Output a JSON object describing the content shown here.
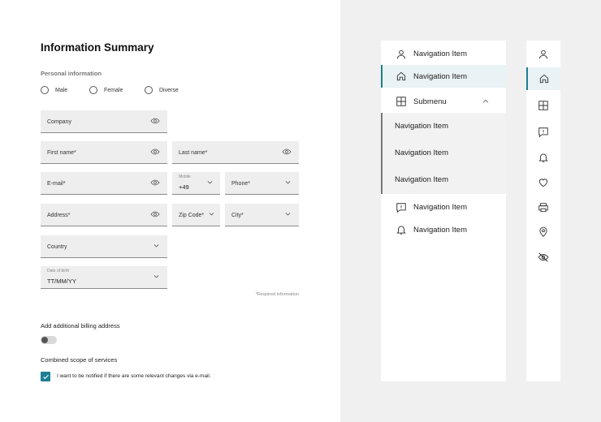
{
  "form": {
    "title": "Information Summary",
    "section_label": "Personal information",
    "gender_options": [
      "Male",
      "Female",
      "Diverse"
    ],
    "company_label": "Company",
    "first_name_label": "First name*",
    "last_name_label": "Last name*",
    "email_label": "E-mail*",
    "mobile_small_label": "Mobile",
    "mobile_value": "+49",
    "phone_label": "Phone*",
    "address_label": "Address*",
    "zip_label": "Zip Code*",
    "city_label": "City*",
    "country_label": "Country",
    "dob_small_label": "Date of birth",
    "dob_value": "TT/MM/YY",
    "required_note": "*Required information",
    "billing_label": "Add additional billing address",
    "billing_toggle_on": false,
    "scope_label": "Combined scope of services",
    "notify_label": "I want to be notified if there are some relevant changes via e-mail.",
    "notify_checked": true
  },
  "nav": {
    "items": [
      {
        "label": "Navigation Item",
        "icon": "user-icon"
      },
      {
        "label": "Navigation Item",
        "icon": "home-icon",
        "active": true
      },
      {
        "label": "Submenu",
        "icon": "grid-icon"
      },
      {
        "label": "Navigation Item",
        "icon": "feedback-icon"
      },
      {
        "label": "Navigation Item",
        "icon": "bell-icon"
      }
    ],
    "sub_items": [
      "Navigation Item",
      "Navigation Item",
      "Navigation Item"
    ]
  },
  "rail": {
    "icons": [
      "user-icon",
      "home-icon",
      "grid-icon",
      "feedback-icon",
      "bell-icon",
      "heart-icon",
      "printer-icon",
      "location-pin-icon",
      "eye-off-icon"
    ],
    "active": "home-icon"
  },
  "colors": {
    "accent": "#1d7f93",
    "field_bg": "#eeeeee",
    "panel_bg": "#f0f0f0",
    "active_bg": "#e9f2f4"
  }
}
